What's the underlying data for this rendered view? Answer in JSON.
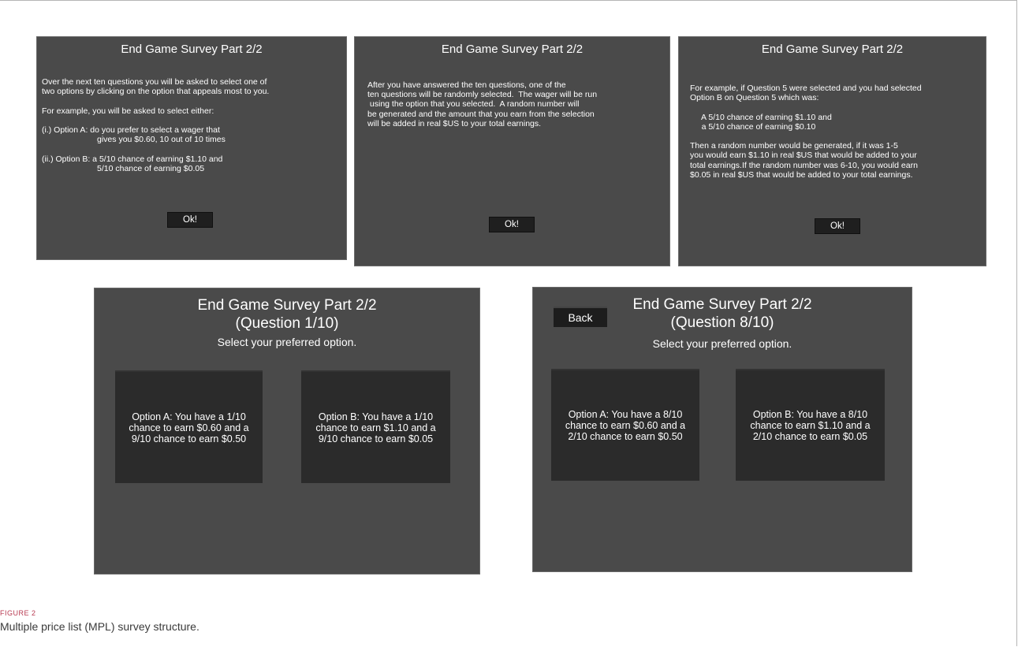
{
  "panel1": {
    "title": "End Game Survey Part 2/2",
    "body": "Over the next ten questions you will be asked to select one of\ntwo options by clicking on the option that appeals most to you.\n\nFor example, you will be asked to select either:\n\n(i.) Option A: do you prefer to select a wager that\n                        gives you $0.60, 10 out of 10 times\n\n(ii.) Option B: a 5/10 chance of earning $1.10 and\n                        5/10 chance of earning $0.05",
    "ok_label": "Ok!"
  },
  "panel2": {
    "title": "End Game Survey Part 2/2",
    "body": "After you have answered the ten questions, one of the\nten questions will be randomly selected.  The wager will be run\n using the option that you selected.  A random number will\nbe generated and the amount that you earn from the selection\nwill be added in real $US to your total earnings.",
    "ok_label": "Ok!"
  },
  "panel3": {
    "title": "End Game Survey Part 2/2",
    "body": "For example, if Question 5 were selected and you had selected\nOption B on Question 5 which was:\n\n     A 5/10 chance of earning $1.10 and\n     a 5/10 chance of earning $0.10\n\nThen a random number would be generated, if it was 1-5\nyou would earn $1.10 in real $US that would be added to your\ntotal earnings.If the random number was 6-10, you would earn\n$0.05 in real $US that would be added to your total earnings.",
    "ok_label": "Ok!"
  },
  "panel4": {
    "title": "End Game Survey Part 2/2",
    "question": "(Question 1/10)",
    "subtitle": "Select your preferred option.",
    "option_a": "Option A: You have a 1/10\nchance to earn $0.60 and a\n9/10 chance to earn $0.50",
    "option_b": "Option B: You have a 1/10\nchance to earn $1.10 and a\n9/10 chance to earn $0.05"
  },
  "panel5": {
    "back_label": "Back",
    "title": "End Game Survey Part 2/2",
    "question": "(Question 8/10)",
    "subtitle": "Select your preferred option.",
    "option_a": "Option A: You have a 8/10\nchance to earn $0.60 and a\n2/10 chance to earn $0.50",
    "option_b": "Option B: You have a 8/10\nchance to earn $1.10 and a\n2/10 chance to earn $0.05"
  },
  "figure": {
    "label": "FIGURE 2",
    "caption": "Multiple price list (MPL) survey structure."
  }
}
